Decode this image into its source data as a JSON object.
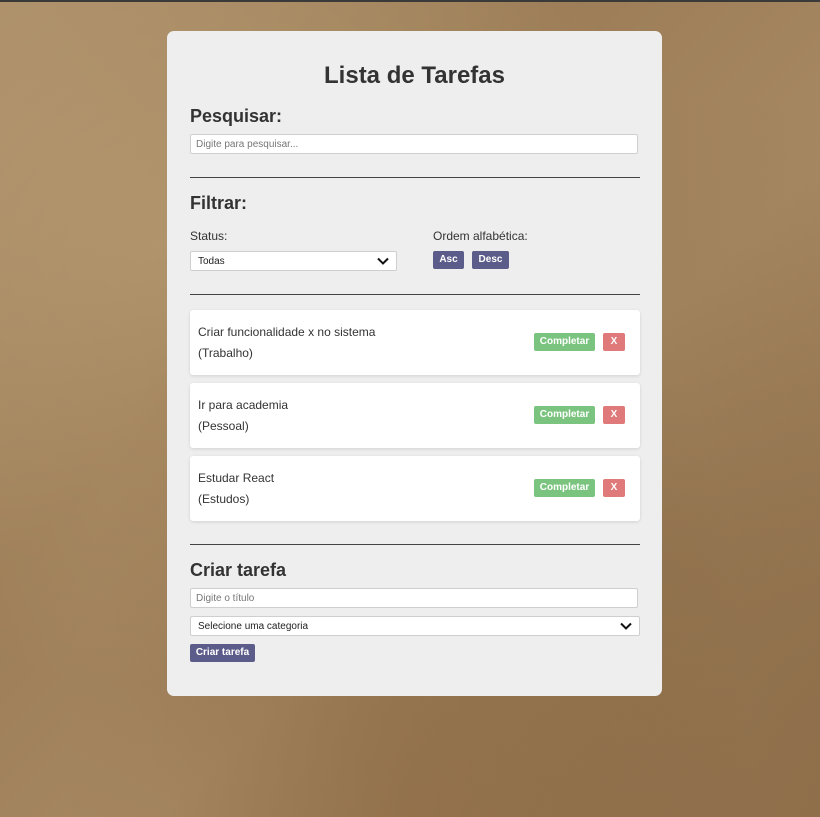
{
  "page": {
    "title": "Lista de Tarefas",
    "search": {
      "heading": "Pesquisar:",
      "placeholder": "Digite para pesquisar..."
    },
    "filter": {
      "heading": "Filtrar:",
      "status_label": "Status:",
      "status_value": "Todas",
      "order_label": "Ordem alfabética:",
      "asc_label": "Asc",
      "desc_label": "Desc"
    },
    "tasks": [
      {
        "title": "Criar funcionalidade x no sistema",
        "category": "(Trabalho)",
        "complete_label": "Completar",
        "remove_label": "X"
      },
      {
        "title": "Ir para academia",
        "category": "(Pessoal)",
        "complete_label": "Completar",
        "remove_label": "X"
      },
      {
        "title": "Estudar React",
        "category": "(Estudos)",
        "complete_label": "Completar",
        "remove_label": "X"
      }
    ],
    "create": {
      "heading": "Criar tarefa",
      "title_placeholder": "Digite o título",
      "category_value": "Selecione uma categoria",
      "submit_label": "Criar tarefa"
    }
  },
  "colors": {
    "accent": "#5c5c8a",
    "complete": "#7bc47f",
    "remove": "#e07a7a",
    "card": "#eeeeee"
  },
  "icons": {
    "dropdown": "chevron-down-icon"
  }
}
